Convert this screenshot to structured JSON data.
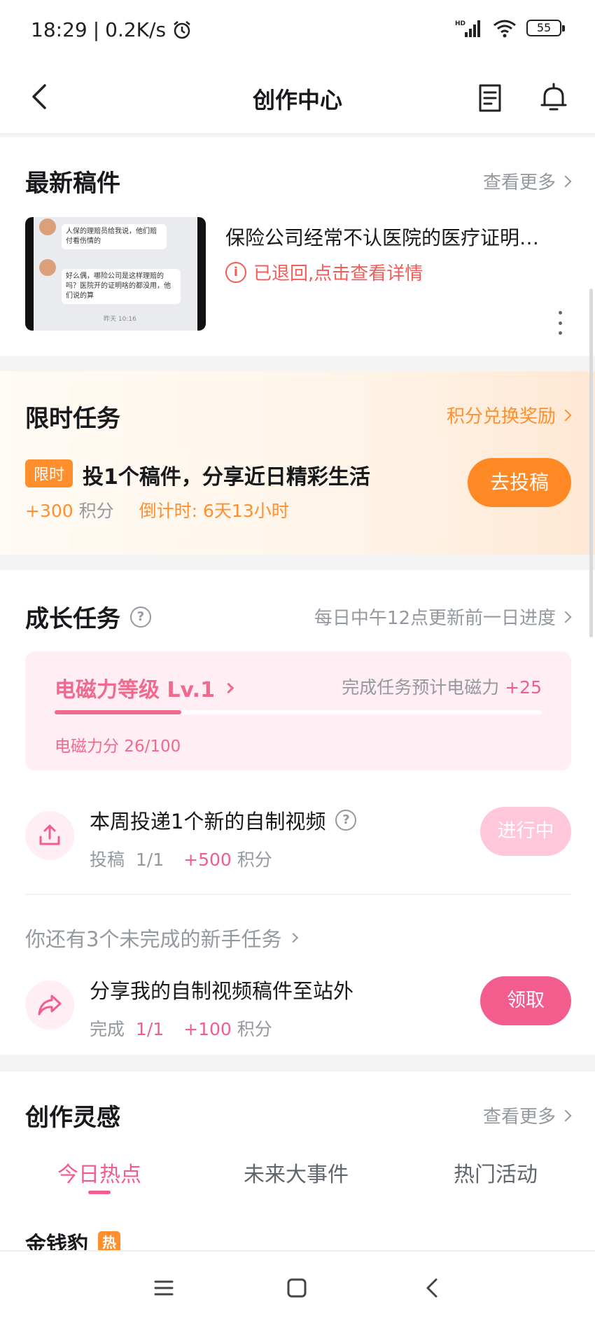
{
  "status_bar": {
    "time": "18:29",
    "separator": "|",
    "net_speed": "0.2K/s",
    "network_label": "HD",
    "battery": "55"
  },
  "nav": {
    "title": "创作中心"
  },
  "latest": {
    "title": "最新稿件",
    "more": "查看更多",
    "item": {
      "title": "保险公司经常不认医院的医疗证明…",
      "status": "已退回,点击查看详情",
      "info_glyph": "i",
      "thumb_lines": [
        "人保的理赔员给我说，他们赔付看伤情的",
        "好么偶，哪险公司是这样理赔的吗？医院开的证明啥的都没用，他们说的算",
        "昨天 10:16"
      ]
    }
  },
  "limited": {
    "title": "限时任务",
    "link": "积分兑换奖励",
    "tag": "限时",
    "task": "投1个稿件，分享近日精彩生活",
    "reward_amount": "+300",
    "reward_unit": "积分",
    "countdown": "倒计时: 6天13小时",
    "button": "去投稿"
  },
  "growth": {
    "title": "成长任务",
    "help_glyph": "?",
    "link": "每日中午12点更新前一日进度",
    "level": {
      "name": "电磁力等级 Lv.1",
      "hint_prefix": "完成任务预计电磁力",
      "hint_value": "+25",
      "score": "电磁力分 26/100",
      "progress": 0.26
    },
    "tasks": [
      {
        "title": "本周投递1个新的自制视频",
        "meta_label": "投稿",
        "meta_progress": "1/1",
        "reward_amount": "+500",
        "reward_unit": "积分",
        "button": "进行中"
      },
      {
        "title": "分享我的自制视频稿件至站外",
        "meta_label": "完成",
        "meta_progress": "1/1",
        "reward_amount": "+100",
        "reward_unit": "积分",
        "button": "领取"
      }
    ],
    "newbie_link": "你还有3个未完成的新手任务"
  },
  "inspiration": {
    "title": "创作灵感",
    "more": "查看更多",
    "tabs": [
      "今日热点",
      "未来大事件",
      "热门活动"
    ],
    "active_tab": 0,
    "first_item": "金钱豹",
    "hot_badge": "热"
  },
  "colors": {
    "pink": "#f25d8e",
    "orange": "#ff8f2c",
    "red": "#f25d59"
  }
}
